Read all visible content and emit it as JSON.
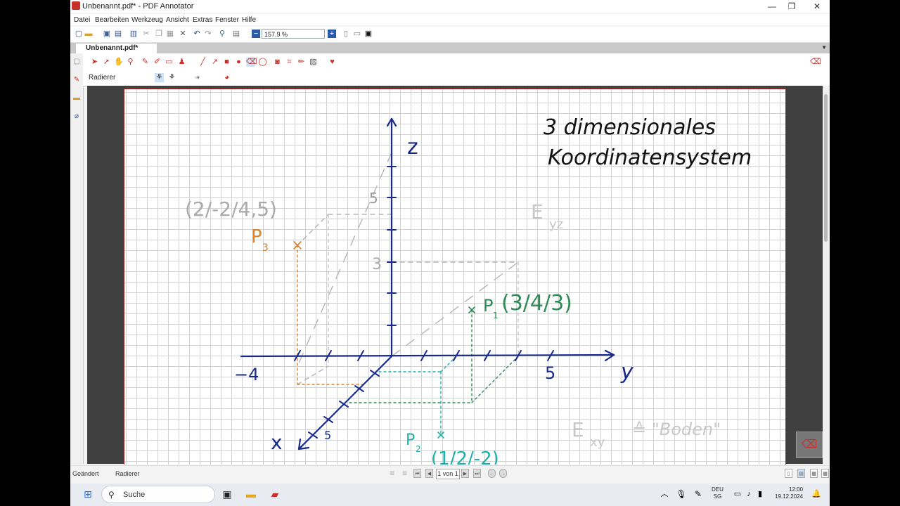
{
  "window": {
    "title": "Unbenannt.pdf* - PDF Annotator",
    "minimize": "—",
    "maximize": "❐",
    "close": "✕"
  },
  "menu": [
    "Datei",
    "Bearbeiten",
    "Werkzeug",
    "Ansicht",
    "Extras",
    "Fenster",
    "Hilfe"
  ],
  "toolbar": {
    "zoom_value": "157.9 %"
  },
  "tabs": {
    "active": "Unbenannt.pdf*"
  },
  "tool_label": "Radierer",
  "drawing": {
    "title_line1": "3 dimensionales",
    "title_line2": "Koordinatensystem",
    "axis_z": "z",
    "axis_y": "y",
    "axis_x": "x",
    "tick_z5": "5",
    "tick_z3": "3",
    "tick_y5": "5",
    "tick_y_neg4": "−4",
    "tick_x5": "5",
    "p3_coords": "(2/-2/4,5)",
    "p3_label": "P",
    "p3_sub": "3",
    "p1_label": "P",
    "p1_sub": "1",
    "p1_coords": "(3/4/3)",
    "p2_label": "P",
    "p2_sub": "2",
    "p2_coords": "(1/2/-2)",
    "eyz_label": "E",
    "eyz_sub": "yz",
    "exy_label": "E",
    "exy_sub": "xy",
    "boden": "≙ \"Boden\""
  },
  "status": {
    "left1": "Geändert",
    "left2": "Radierer",
    "page_indicator": "1 von 1"
  },
  "taskbar": {
    "search_placeholder": "Suche",
    "lang": "DEU",
    "region": "SG",
    "time": "12:00",
    "date": "19.12.2024"
  },
  "colors": {
    "axes": "#1a2a8a",
    "p1": "#2e8b57",
    "p2": "#20b2aa",
    "p3": "#d9822b",
    "guide": "#b9b9b9",
    "accent": "#c8312a"
  }
}
